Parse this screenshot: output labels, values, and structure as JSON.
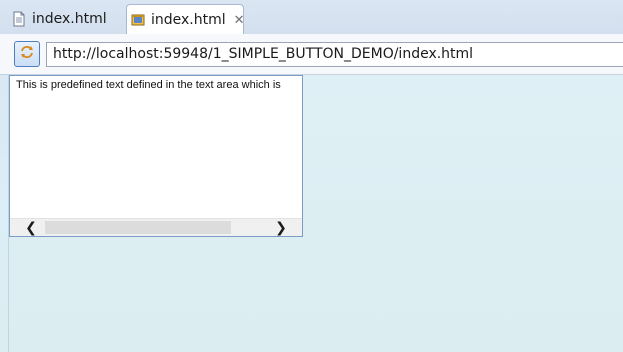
{
  "tabs": [
    {
      "label": "index.html",
      "icon": "document-icon",
      "active": false
    },
    {
      "label": "index.html",
      "icon": "browser-icon",
      "active": true,
      "close": "✕"
    }
  ],
  "toolbar": {
    "refresh_icon": "refresh-icon"
  },
  "urlbar": {
    "value": "http://localhost:59948/1_SIMPLE_BUTTON_DEMO/index.html"
  },
  "textarea": {
    "value": "This is predefined text defined in the text area which is"
  },
  "scrollbar": {
    "left_arrow": "❮",
    "right_arrow": "❯"
  },
  "colors": {
    "accent": "#4f7fc0",
    "page_background": "#dcedf1"
  }
}
